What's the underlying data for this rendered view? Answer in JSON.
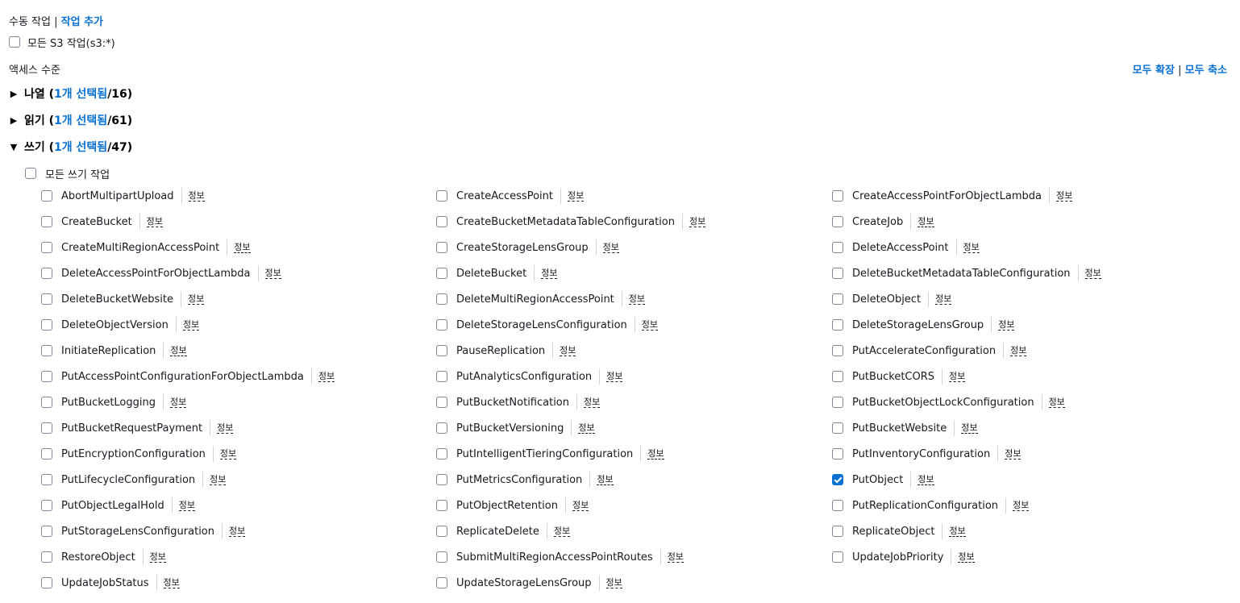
{
  "header": {
    "manual_actions": "수동 작업",
    "separator": "|",
    "add_actions": "작업 추가"
  },
  "all_s3": {
    "label": "모든 S3 작업(s3:*)"
  },
  "access_level": {
    "label": "액세스 수준",
    "expand_all": "모두 확장",
    "separator": "|",
    "collapse_all": "모두 축소"
  },
  "groups": [
    {
      "caret": "▶",
      "name": "나열 (",
      "selected": "1개 선택됨",
      "total": "/16)"
    },
    {
      "caret": "▶",
      "name": "읽기 (",
      "selected": "1개 선택됨",
      "total": "/61)"
    },
    {
      "caret": "▼",
      "name": "쓰기 (",
      "selected": "1개 선택됨",
      "total": "/47)"
    }
  ],
  "write": {
    "all_label": "모든 쓰기 작업",
    "info_label": "정보",
    "columns": [
      [
        "AbortMultipartUpload",
        "CreateBucket",
        "CreateMultiRegionAccessPoint",
        "DeleteAccessPointForObjectLambda",
        "DeleteBucketWebsite",
        "DeleteObjectVersion",
        "InitiateReplication",
        "PutAccessPointConfigurationForObjectLambda",
        "PutBucketLogging",
        "PutBucketRequestPayment",
        "PutEncryptionConfiguration",
        "PutLifecycleConfiguration",
        "PutObjectLegalHold",
        "PutStorageLensConfiguration",
        "RestoreObject",
        "UpdateJobStatus"
      ],
      [
        "CreateAccessPoint",
        "CreateBucketMetadataTableConfiguration",
        "CreateStorageLensGroup",
        "DeleteBucket",
        "DeleteMultiRegionAccessPoint",
        "DeleteStorageLensConfiguration",
        "PauseReplication",
        "PutAnalyticsConfiguration",
        "PutBucketNotification",
        "PutBucketVersioning",
        "PutIntelligentTieringConfiguration",
        "PutMetricsConfiguration",
        "PutObjectRetention",
        "ReplicateDelete",
        "SubmitMultiRegionAccessPointRoutes",
        "UpdateStorageLensGroup"
      ],
      [
        "CreateAccessPointForObjectLambda",
        "CreateJob",
        "DeleteAccessPoint",
        "DeleteBucketMetadataTableConfiguration",
        "DeleteObject",
        "DeleteStorageLensGroup",
        "PutAccelerateConfiguration",
        "PutBucketCORS",
        "PutBucketObjectLockConfiguration",
        "PutBucketWebsite",
        "PutInventoryConfiguration",
        "PutObject",
        "PutReplicationConfiguration",
        "ReplicateObject",
        "UpdateJobPriority"
      ]
    ],
    "checked": [
      "PutObject"
    ]
  }
}
